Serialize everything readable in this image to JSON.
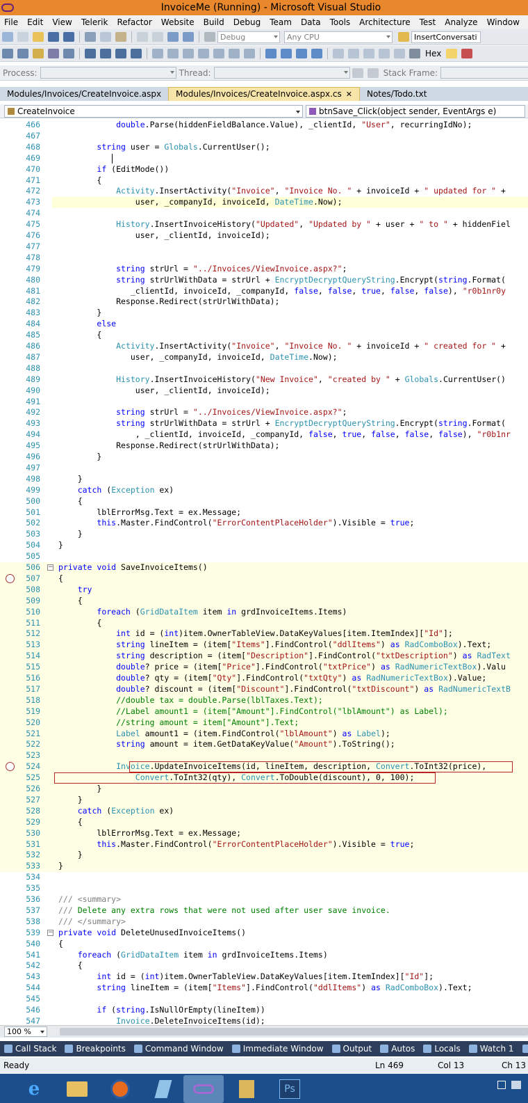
{
  "window": {
    "title": "InvoiceMe (Running) - Microsoft Visual Studio"
  },
  "menu": [
    "File",
    "Edit",
    "View",
    "Telerik",
    "Refactor",
    "Website",
    "Build",
    "Debug",
    "Team",
    "Data",
    "Tools",
    "Architecture",
    "Test",
    "Analyze",
    "Window",
    "Help"
  ],
  "toolbar": {
    "config": "Debug",
    "platform": "Any CPU",
    "find_value": "InsertConversati",
    "hex_label": "Hex",
    "process_label": "Process:",
    "thread_label": "Thread:",
    "stackframe_label": "Stack Frame:"
  },
  "tabs": [
    {
      "label": "Modules/Invoices/CreateInvoice.aspx",
      "active": false
    },
    {
      "label": "Modules/Invoices/CreateInvoice.aspx.cs",
      "active": true,
      "close": "✕"
    },
    {
      "label": "Notes/Todo.txt",
      "active": false
    }
  ],
  "navbar": {
    "class_combo": "CreateInvoice",
    "member_combo": "btnSave_Click(object sender, EventArgs e)"
  },
  "code_lines": [
    {
      "n": "466",
      "t": "            double.Parse(hiddenFieldBalance.Value), _clientId, \"User\", recurringIdNo);"
    },
    {
      "n": "467",
      "t": ""
    },
    {
      "n": "468",
      "t": "        string user = Globals.CurrentUser();"
    },
    {
      "n": "469",
      "t": ""
    },
    {
      "n": "470",
      "t": "        if (EditMode())"
    },
    {
      "n": "471",
      "t": "        {"
    },
    {
      "n": "472",
      "t": "            Activity.InsertActivity(\"Invoice\", \"Invoice No. \" + invoiceId + \" updated for \" +"
    },
    {
      "n": "473",
      "t": "                user, _companyId, invoiceId, DateTime.Now);"
    },
    {
      "n": "474",
      "t": ""
    },
    {
      "n": "475",
      "t": "            History.InsertInvoiceHistory(\"Updated\", \"Updated by \" + user + \" to \" + hiddenFiel"
    },
    {
      "n": "476",
      "t": "                user, _clientId, invoiceId);"
    },
    {
      "n": "477",
      "t": ""
    },
    {
      "n": "478",
      "t": ""
    },
    {
      "n": "479",
      "t": "            string strUrl = \"../Invoices/ViewInvoice.aspx?\";"
    },
    {
      "n": "480",
      "t": "            string strUrlWithData = strUrl + EncryptDecryptQueryString.Encrypt(string.Format("
    },
    {
      "n": "481",
      "t": "               _clientId, invoiceId, _companyId, false, false, true, false, false), \"r0b1nr0y"
    },
    {
      "n": "482",
      "t": "            Response.Redirect(strUrlWithData);"
    },
    {
      "n": "483",
      "t": "        }"
    },
    {
      "n": "484",
      "t": "        else"
    },
    {
      "n": "485",
      "t": "        {"
    },
    {
      "n": "486",
      "t": "            Activity.InsertActivity(\"Invoice\", \"Invoice No. \" + invoiceId + \" created for \" +"
    },
    {
      "n": "487",
      "t": "               user, _companyId, invoiceId, DateTime.Now);"
    },
    {
      "n": "488",
      "t": ""
    },
    {
      "n": "489",
      "t": "            History.InsertInvoiceHistory(\"New Invoice\", \"created by \" + Globals.CurrentUser()"
    },
    {
      "n": "490",
      "t": "                user, _clientId, invoiceId);"
    },
    {
      "n": "491",
      "t": ""
    },
    {
      "n": "492",
      "t": "            string strUrl = \"../Invoices/ViewInvoice.aspx?\";"
    },
    {
      "n": "493",
      "t": "            string strUrlWithData = strUrl + EncryptDecryptQueryString.Encrypt(string.Format("
    },
    {
      "n": "494",
      "t": "                , _clientId, invoiceId, _companyId, false, true, false, false, false), \"r0b1nr"
    },
    {
      "n": "495",
      "t": "            Response.Redirect(strUrlWithData);"
    },
    {
      "n": "496",
      "t": "        }"
    },
    {
      "n": "497",
      "t": ""
    },
    {
      "n": "498",
      "t": "    }"
    },
    {
      "n": "499",
      "t": "    catch (Exception ex)"
    },
    {
      "n": "500",
      "t": "    {"
    },
    {
      "n": "501",
      "t": "        lblErrorMsg.Text = ex.Message;"
    },
    {
      "n": "502",
      "t": "        this.Master.FindControl(\"ErrorContentPlaceHolder\").Visible = true;"
    },
    {
      "n": "503",
      "t": "    }"
    },
    {
      "n": "504",
      "t": "}"
    },
    {
      "n": "505",
      "t": ""
    },
    {
      "n": "506",
      "t": "private void SaveInvoiceItems()"
    },
    {
      "n": "507",
      "t": "{"
    },
    {
      "n": "508",
      "t": "    try"
    },
    {
      "n": "509",
      "t": "    {"
    },
    {
      "n": "510",
      "t": "        foreach (GridDataItem item in grdInvoiceItems.Items)"
    },
    {
      "n": "511",
      "t": "        {"
    },
    {
      "n": "512",
      "t": "            int id = (int)item.OwnerTableView.DataKeyValues[item.ItemIndex][\"Id\"];"
    },
    {
      "n": "513",
      "t": "            string lineItem = (item[\"Items\"].FindControl(\"ddlItems\") as RadComboBox).Text;"
    },
    {
      "n": "514",
      "t": "            string description = (item[\"Description\"].FindControl(\"txtDescription\") as RadText"
    },
    {
      "n": "515",
      "t": "            double? price = (item[\"Price\"].FindControl(\"txtPrice\") as RadNumericTextBox).Valu"
    },
    {
      "n": "516",
      "t": "            double? qty = (item[\"Qty\"].FindControl(\"txtQty\") as RadNumericTextBox).Value;"
    },
    {
      "n": "517",
      "t": "            double? discount = (item[\"Discount\"].FindControl(\"txtDiscount\") as RadNumericTextB"
    },
    {
      "n": "518",
      "t": "            //double tax = double.Parse(lblTaxes.Text);"
    },
    {
      "n": "519",
      "t": "            //Label amount1 = (item[\"Amount\"].FindControl(\"lblAmount\") as Label);"
    },
    {
      "n": "520",
      "t": "            //string amount = item[\"Amount\"].Text;"
    },
    {
      "n": "521",
      "t": "            Label amount1 = (item.FindControl(\"lblAmount\") as Label);"
    },
    {
      "n": "522",
      "t": "            string amount = item.GetDataKeyValue(\"Amount\").ToString();"
    },
    {
      "n": "523",
      "t": ""
    },
    {
      "n": "524",
      "t": "            Invoice.UpdateInvoiceItems(id, lineItem, description, Convert.ToInt32(price),"
    },
    {
      "n": "525",
      "t": "                Convert.ToInt32(qty), Convert.ToDouble(discount), 0, 100);"
    },
    {
      "n": "526",
      "t": "        }"
    },
    {
      "n": "527",
      "t": "    }"
    },
    {
      "n": "528",
      "t": "    catch (Exception ex)"
    },
    {
      "n": "529",
      "t": "    {"
    },
    {
      "n": "530",
      "t": "        lblErrorMsg.Text = ex.Message;"
    },
    {
      "n": "531",
      "t": "        this.Master.FindControl(\"ErrorContentPlaceHolder\").Visible = true;"
    },
    {
      "n": "532",
      "t": "    }"
    },
    {
      "n": "533",
      "t": "}"
    },
    {
      "n": "534",
      "t": ""
    },
    {
      "n": "535",
      "t": ""
    },
    {
      "n": "536",
      "t": "/// <summary>"
    },
    {
      "n": "537",
      "t": "/// Delete any extra rows that were not used after user save invoice."
    },
    {
      "n": "538",
      "t": "/// </summary>"
    },
    {
      "n": "539",
      "t": "private void DeleteUnusedInvoiceItems()"
    },
    {
      "n": "540",
      "t": "{"
    },
    {
      "n": "541",
      "t": "    foreach (GridDataItem item in grdInvoiceItems.Items)"
    },
    {
      "n": "542",
      "t": "    {"
    },
    {
      "n": "543",
      "t": "        int id = (int)item.OwnerTableView.DataKeyValues[item.ItemIndex][\"Id\"];"
    },
    {
      "n": "544",
      "t": "        string lineItem = (item[\"Items\"].FindControl(\"ddlItems\") as RadComboBox).Text;"
    },
    {
      "n": "545",
      "t": ""
    },
    {
      "n": "546",
      "t": "        if (string.IsNullOrEmpty(lineItem))"
    },
    {
      "n": "547",
      "t": "            Invoice.DeleteInvoiceItems(id);"
    }
  ],
  "zoom": "100 %",
  "bottom_tabs": [
    "Call Stack",
    "Breakpoints",
    "Command Window",
    "Immediate Window",
    "Output",
    "Autos",
    "Locals",
    "Watch 1",
    "Find Sym"
  ],
  "status": {
    "state": "Ready",
    "line": "Ln 469",
    "col": "Col 13",
    "ch": "Ch 13"
  },
  "taskbar": {
    "ps_label": "Ps"
  },
  "colors": {
    "title_bar": "#e8872b",
    "tab_active": "#f7e4a8",
    "bottom_panel": "#2d3e5c",
    "taskbar": "#1b4e8a",
    "breakpoint": "#a33"
  }
}
